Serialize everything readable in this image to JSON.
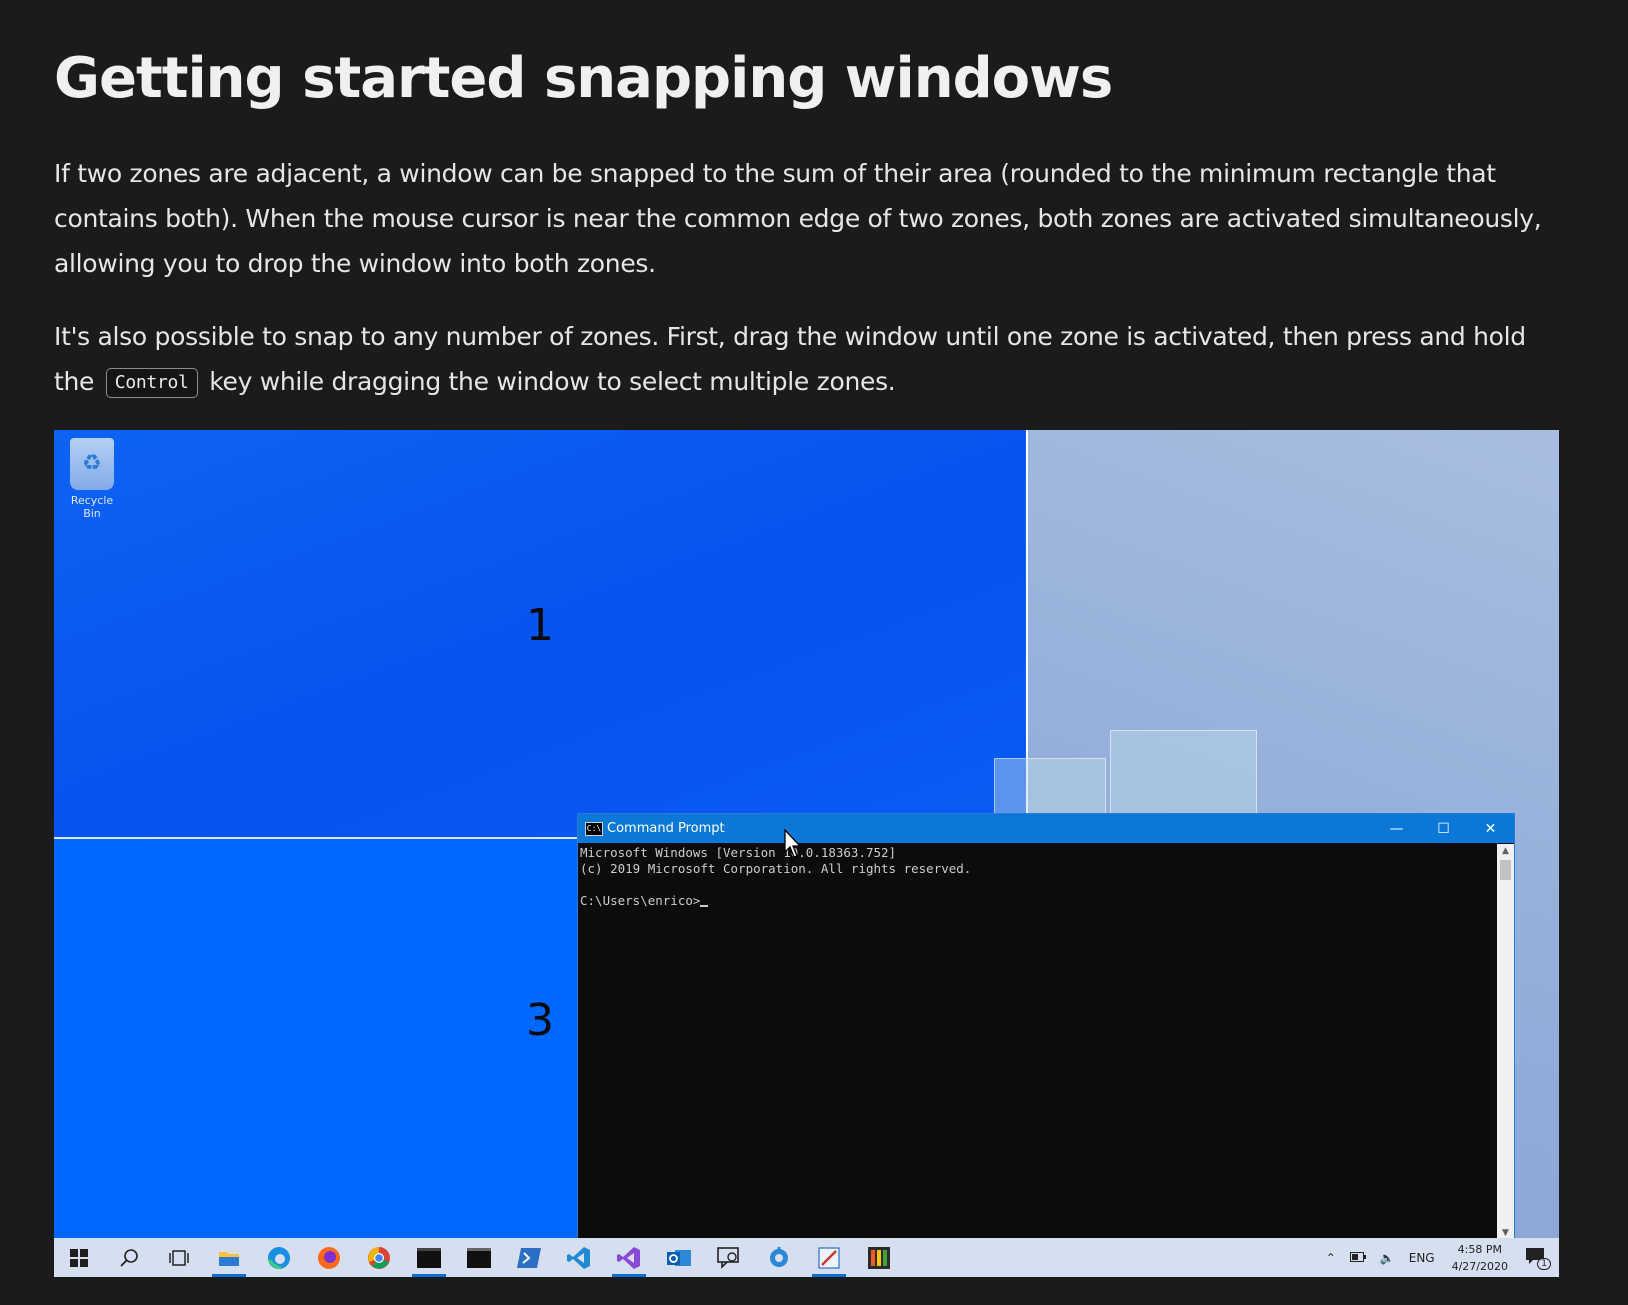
{
  "heading": "Getting started snapping windows",
  "paragraph1": "If two zones are adjacent, a window can be snapped to the sum of their area (rounded to the minimum rectangle that contains both). When the mouse cursor is near the common edge of two zones, both zones are activated simultaneously, allowing you to drop the window into both zones.",
  "paragraph2": {
    "before": "It's also possible to snap to any number of zones. First, drag the window until one zone is activated, then press and hold the",
    "key": "Control",
    "after": "key while dragging the window to select multiple zones."
  },
  "screenshot": {
    "desktop": {
      "recycle_bin_label": "Recycle Bin",
      "zone_labels": [
        "1",
        "3"
      ]
    },
    "cmd_window": {
      "title": "Command Prompt",
      "lines": [
        "Microsoft Windows [Version 10.0.18363.752]",
        "(c) 2019 Microsoft Corporation. All rights reserved.",
        "",
        "C:\\Users\\enrico>"
      ]
    },
    "taskbar": {
      "icons": [
        "windows-start-icon",
        "search-icon",
        "task-view-icon",
        "file-explorer-icon",
        "edge-icon",
        "firefox-icon",
        "chrome-icon",
        "terminal-icon",
        "cmd-icon",
        "powershell-icon",
        "vscode-icon",
        "visual-studio-icon",
        "outlook-icon",
        "feedback-icon",
        "teams-icon",
        "paint-icon",
        "powertoys-icon"
      ],
      "language": "ENG",
      "time": "4:58 PM",
      "date": "4/27/2020",
      "notification_count": "1"
    }
  }
}
